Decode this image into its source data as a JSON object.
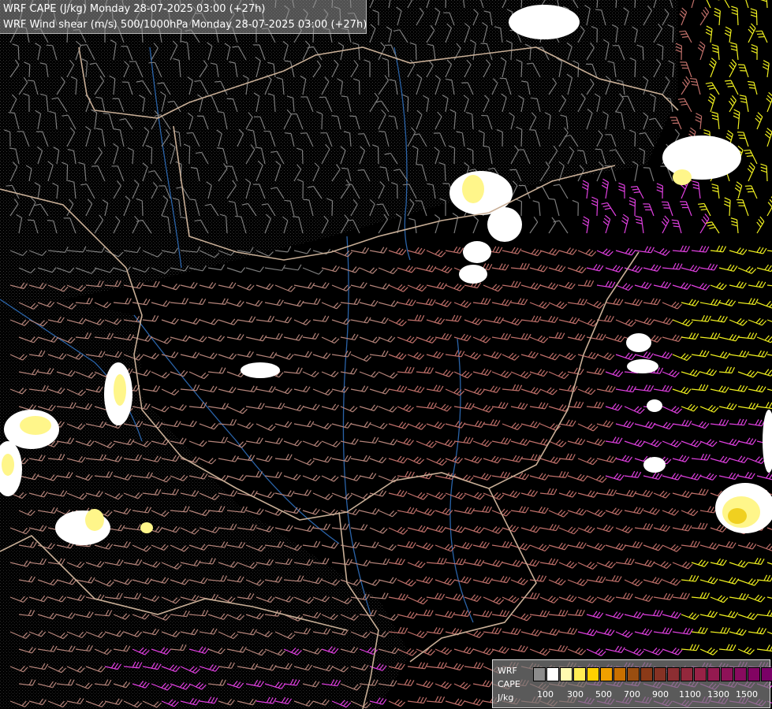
{
  "title": {
    "line1": "WRF CAPE (J/kg) Monday 28-07-2025 03:00 (+27h)",
    "line2": "WRF Wind shear (m/s) 500/1000hPa Monday 28-07-2025 03:00 (+27h)"
  },
  "legend": {
    "label_top": "WRF",
    "label_mid": "CAPE",
    "label_unit": "J/kg",
    "ticks": [
      "100",
      "300",
      "500",
      "700",
      "900",
      "1100",
      "1300",
      "1500"
    ],
    "colors": [
      "#8c8c8c",
      "#ffffff",
      "#fffbb0",
      "#ffee55",
      "#ffd000",
      "#f0a000",
      "#c87000",
      "#9a4e10",
      "#8a3a18",
      "#853224",
      "#8c2e32",
      "#93283c",
      "#972246",
      "#941a50",
      "#8e1258",
      "#880b5e",
      "#820462",
      "#7a0066"
    ]
  },
  "map": {
    "background": "#000000",
    "border_color": "#c8ae96",
    "river_color": "#2a63a8",
    "barb_colors": {
      "weak": "#7d7d7d",
      "moderate": "#b5847a",
      "strong": "#c0706a",
      "very_strong": "#e040e0",
      "extreme": "#f0f020"
    },
    "cape_colors": {
      "low": "#ffffff",
      "mid": "#fff68a",
      "high": "#f0d020"
    }
  }
}
